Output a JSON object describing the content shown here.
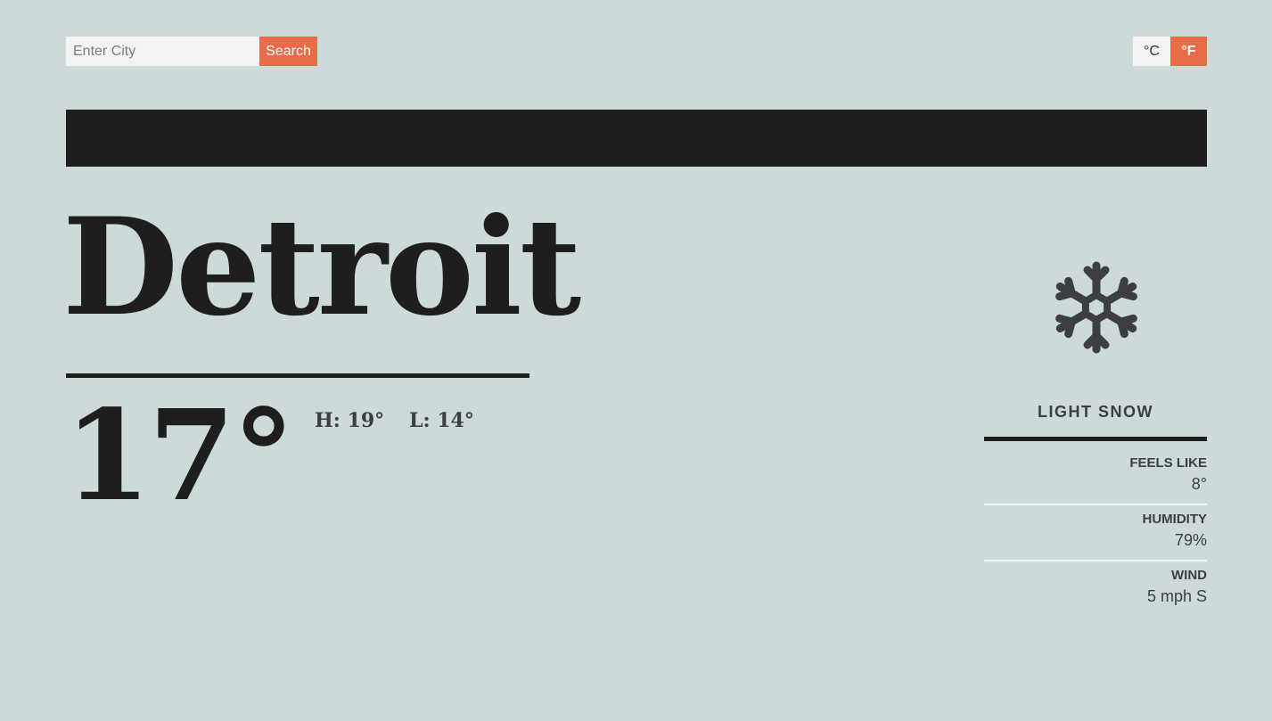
{
  "search": {
    "placeholder": "Enter City",
    "button_label": "Search"
  },
  "units": {
    "celsius_label": "°C",
    "fahrenheit_label": "°F",
    "selected": "°F"
  },
  "location": {
    "city": "Detroit"
  },
  "current": {
    "temperature": "17°",
    "high": "H: 19°",
    "low": "L: 14°",
    "condition": "LIGHT SNOW",
    "icon": "snowflake-icon"
  },
  "details": [
    {
      "label": "FEELS LIKE",
      "value": "8°"
    },
    {
      "label": "HUMIDITY",
      "value": "79%"
    },
    {
      "label": "WIND",
      "value": "5 mph S"
    }
  ],
  "colors": {
    "background": "#ccdada",
    "accent": "#ea6b48",
    "dark": "#1e1e1e",
    "text_muted": "#3c3f42"
  }
}
